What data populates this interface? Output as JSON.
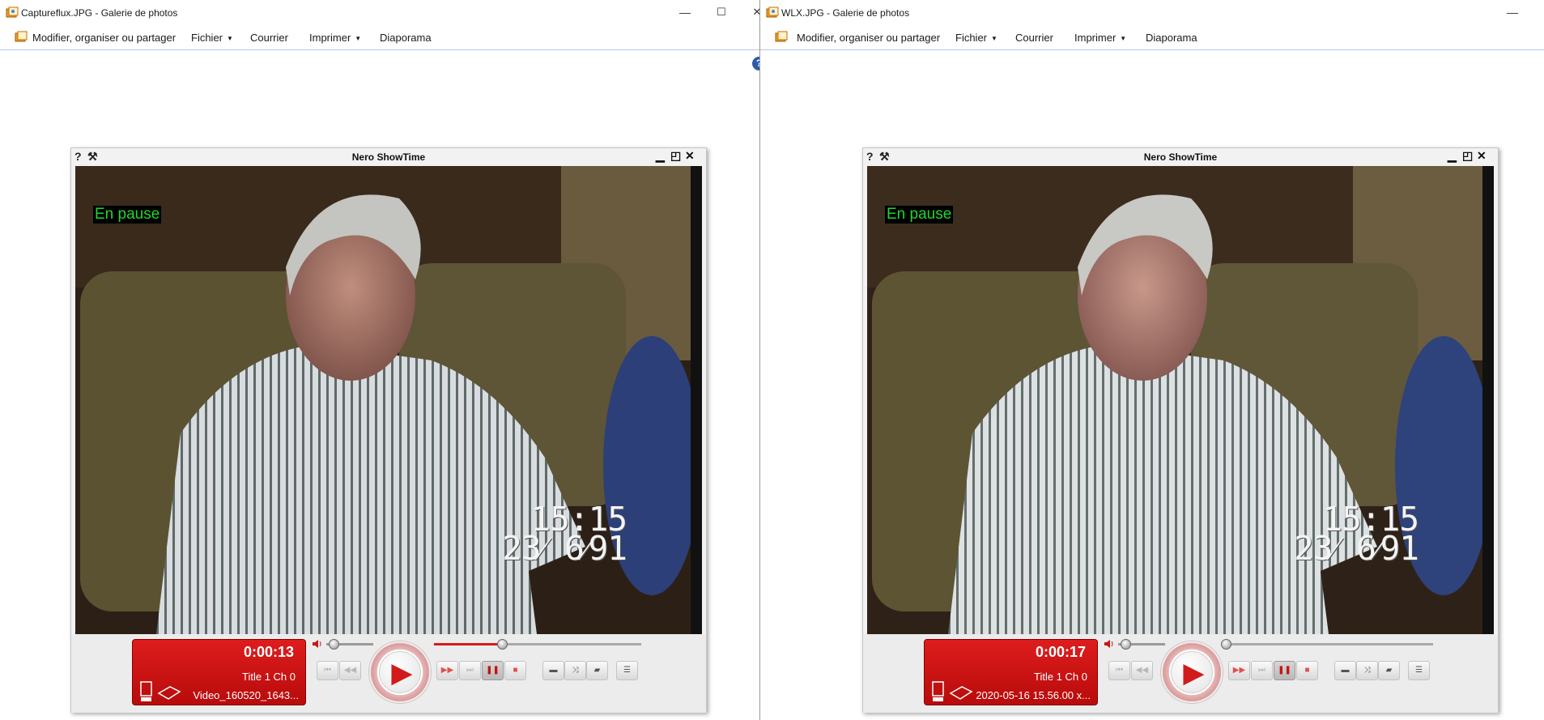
{
  "left_window": {
    "title": "Captureflux.JPG - Galerie de photos",
    "controls": {
      "minimize": "—",
      "maximize": "☐",
      "close": "✕"
    },
    "menu": {
      "organise": "Modifier, organiser ou partager",
      "file": "Fichier",
      "mail": "Courrier",
      "print": "Imprimer",
      "slideshow": "Diaporama",
      "help": "?"
    },
    "player": {
      "title": "Nero ShowTime",
      "status": "En pause",
      "osd_time": "15:15",
      "osd_date": "23⁄ 6⁄91",
      "elapsed": "0:00:13",
      "chapter_info": "Title  1    Ch 0",
      "filename": "Video_160520_1643...",
      "seek_fraction": 0.33,
      "volume_fraction": 0.15
    }
  },
  "right_window": {
    "title": "WLX.JPG - Galerie de photos",
    "controls": {
      "minimize": "—"
    },
    "menu": {
      "organise": "Modifier, organiser ou partager",
      "file": "Fichier",
      "mail": "Courrier",
      "print": "Imprimer",
      "slideshow": "Diaporama"
    },
    "player": {
      "title": "Nero ShowTime",
      "status": "En pause",
      "osd_time": "15:15",
      "osd_date": "23⁄ 6⁄91",
      "elapsed": "0:00:17",
      "chapter_info": "Title  1    Ch 0",
      "filename": "2020-05-16 15.56.00 x...",
      "seek_fraction": 0.0,
      "volume_fraction": 0.15
    }
  },
  "player_common": {
    "help_glyph": "?",
    "tool_glyph": "⚒",
    "btn_minimize": "▁",
    "btn_restore": "◰",
    "btn_close": "✕",
    "icons": [
      "skip-back-icon",
      "step-back-icon",
      "play-icon",
      "step-forward-icon",
      "skip-forward-icon",
      "pause-icon",
      "stop-icon",
      "repeat-icon",
      "shuffle-icon",
      "folder-icon",
      "playlist-icon"
    ],
    "accent_red": "#d81a1a"
  }
}
